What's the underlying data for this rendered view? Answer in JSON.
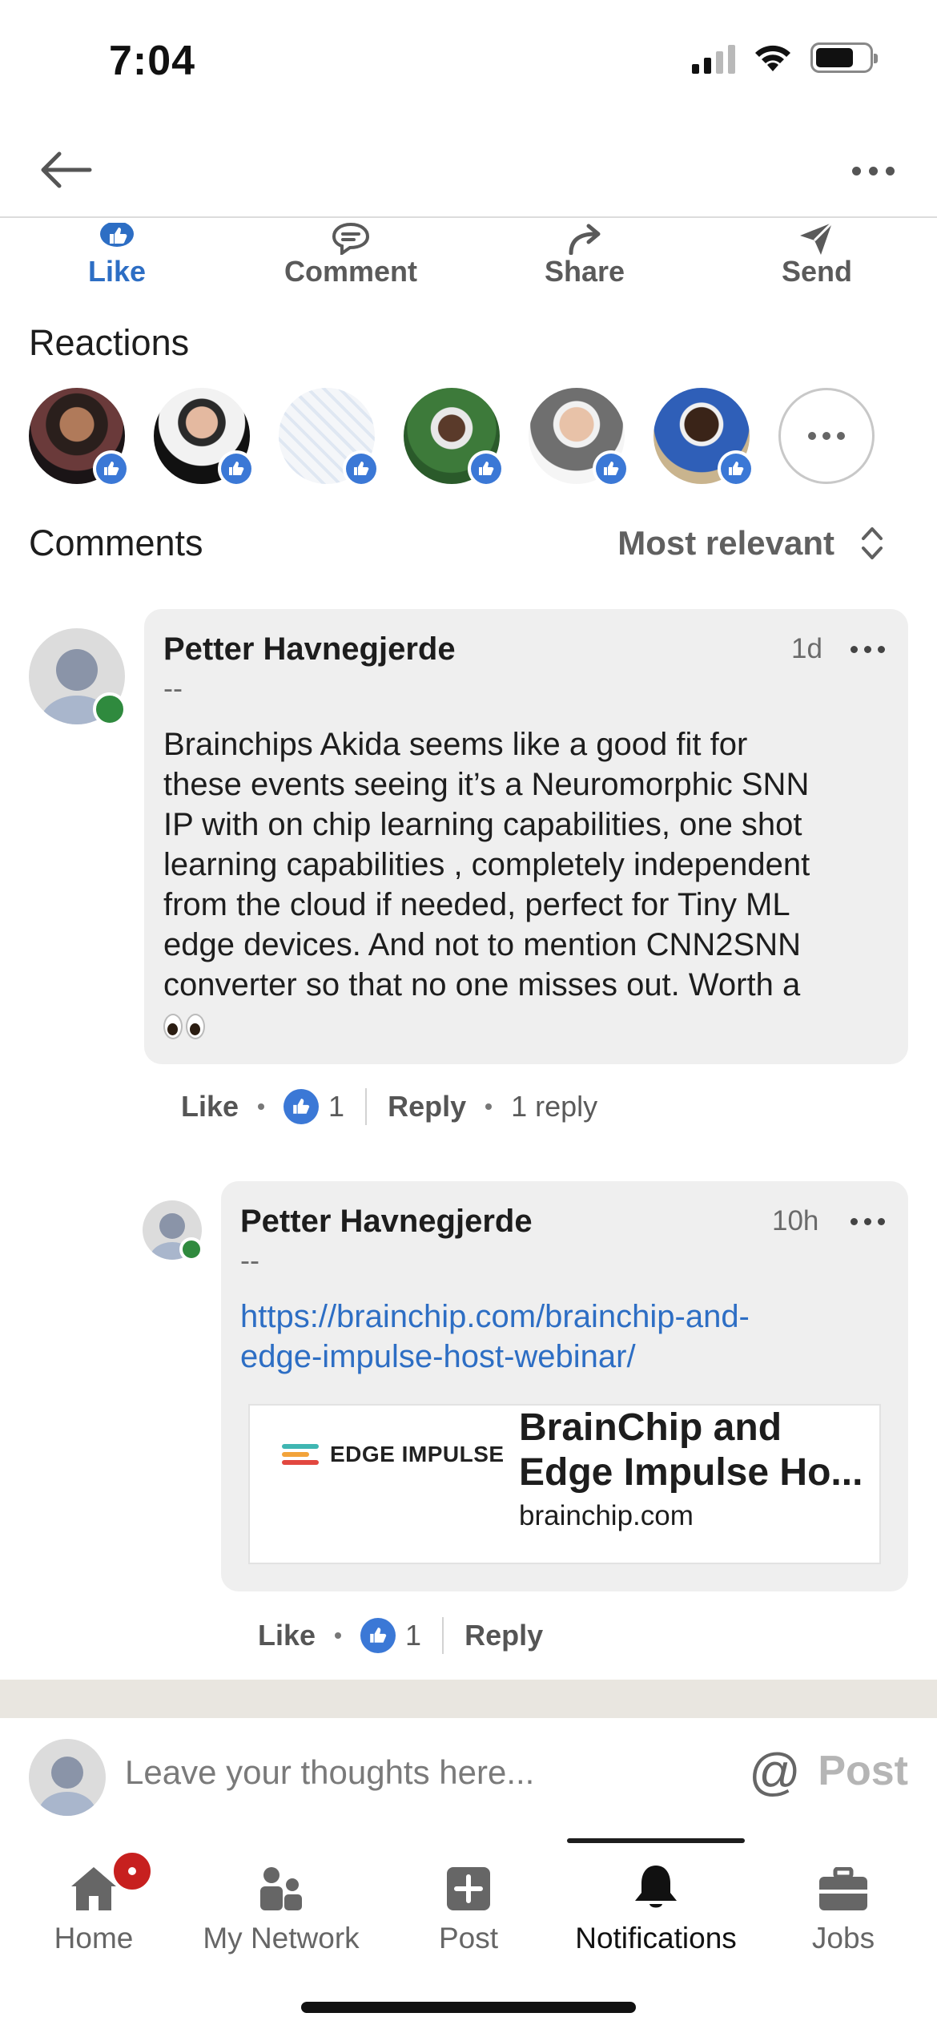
{
  "status": {
    "time": "7:04"
  },
  "actions": [
    {
      "label": "Like",
      "icon": "like-icon",
      "active": true
    },
    {
      "label": "Comment",
      "icon": "comment-icon"
    },
    {
      "label": "Share",
      "icon": "share-icon"
    },
    {
      "label": "Send",
      "icon": "send-icon"
    }
  ],
  "reactions": {
    "title": "Reactions",
    "avatars": [
      "avatar-1",
      "avatar-2",
      "avatar-3",
      "avatar-4",
      "avatar-5",
      "avatar-6"
    ],
    "more": "more-reactions"
  },
  "comments_header": {
    "title": "Comments",
    "sort": "Most relevant"
  },
  "comment1": {
    "author": "Petter Havnegjerde",
    "headline": "--",
    "time": "1d",
    "body_lines": [
      "Brainchips Akida seems like a good fit for",
      "these events seeing it’s a Neuromorphic SNN",
      "IP with on chip learning capabilities, one shot",
      "learning capabilities , completely independent",
      "from the cloud if needed, perfect for Tiny ML",
      "edge devices.  And not to mention CNN2SNN",
      "converter so that no one misses out. Worth a"
    ],
    "like": "Like",
    "like_count": "1",
    "reply": "Reply",
    "replies": "1 reply"
  },
  "comment2": {
    "author": "Petter Havnegjerde",
    "headline": "--",
    "time": "10h",
    "link_lines": [
      "https://brainchip.com/brainchip-and-",
      "edge-impulse-host-webinar/"
    ],
    "preview": {
      "logo_text": "EDGE IMPULSE",
      "title_lines": [
        "BrainChip and",
        "Edge Impulse Ho..."
      ],
      "domain": "brainchip.com"
    },
    "like": "Like",
    "like_count": "1",
    "reply": "Reply"
  },
  "input": {
    "placeholder": "Leave your thoughts here...",
    "at": "@",
    "post": "Post"
  },
  "tabs": [
    {
      "label": "Home"
    },
    {
      "label": "My Network"
    },
    {
      "label": "Post"
    },
    {
      "label": "Notifications",
      "active": true
    },
    {
      "label": "Jobs"
    }
  ],
  "colors": {
    "accent": "#2d6ec4",
    "online": "#2f8a3e",
    "badge": "#c7201f"
  }
}
